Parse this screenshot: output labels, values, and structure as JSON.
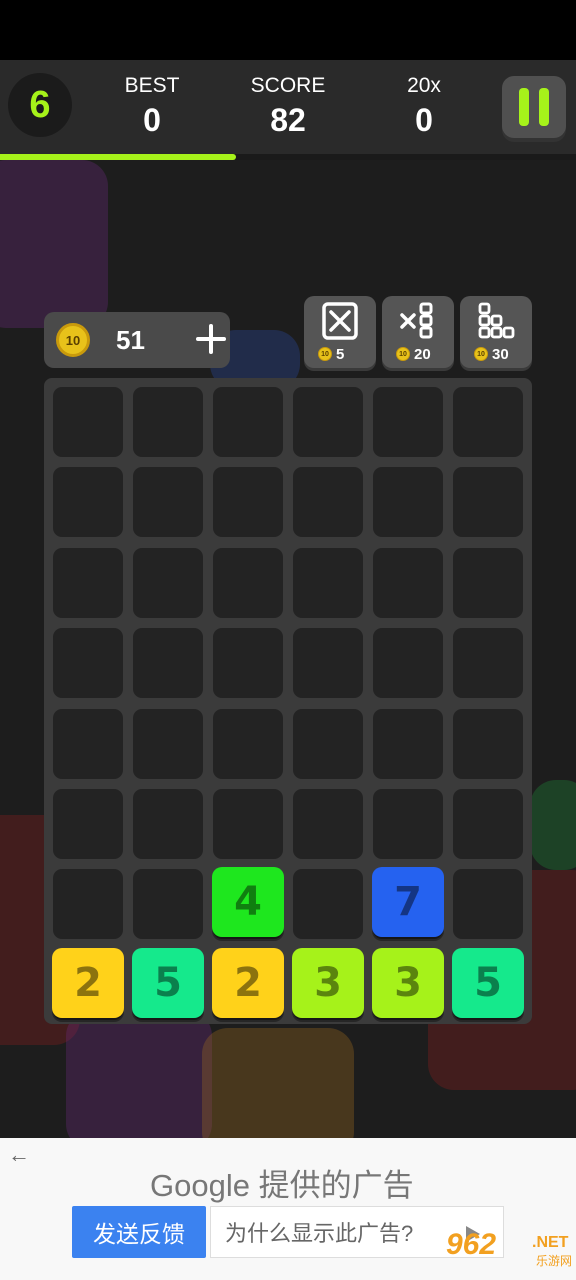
{
  "header": {
    "level": "6",
    "best_label": "BEST",
    "best_value": "0",
    "score_label": "SCORE",
    "score_value": "82",
    "multiplier_label": "20x",
    "multiplier_value": "0",
    "level_progress": 0.41,
    "accent_color": "#a6f21a"
  },
  "coins": {
    "coin_face": "10",
    "count": "51"
  },
  "powerups": [
    {
      "name": "remove-block",
      "icon": "x-box-icon",
      "cost": "5"
    },
    {
      "name": "multiply-column",
      "icon": "multiply-column-icon",
      "cost": "20"
    },
    {
      "name": "rearrange",
      "icon": "grid-blocks-icon",
      "cost": "30"
    }
  ],
  "board": {
    "rows": 8,
    "cols": 6,
    "tiles": [
      {
        "row": 6,
        "col": 2,
        "value": "4",
        "color": "#1ee71e"
      },
      {
        "row": 6,
        "col": 4,
        "value": "7",
        "color": "#2562f0"
      },
      {
        "row": 7,
        "col": 0,
        "value": "2",
        "color": "#ffd21a"
      },
      {
        "row": 7,
        "col": 1,
        "value": "5",
        "color": "#15e98c"
      },
      {
        "row": 7,
        "col": 2,
        "value": "2",
        "color": "#ffd21a"
      },
      {
        "row": 7,
        "col": 3,
        "value": "3",
        "color": "#a6f21a"
      },
      {
        "row": 7,
        "col": 4,
        "value": "3",
        "color": "#a6f21a"
      },
      {
        "row": 7,
        "col": 5,
        "value": "5",
        "color": "#15e98c"
      }
    ]
  },
  "ad": {
    "title": "Google 提供的广告",
    "feedback_label": "发送反馈",
    "why_label": "为什么显示此广告?"
  },
  "watermark": {
    "main": "962",
    "net": ".NET",
    "cn": "乐游网"
  }
}
